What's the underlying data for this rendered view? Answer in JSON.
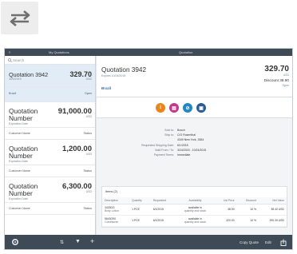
{
  "toggle_icon": "swap-arrows-icon",
  "topbar": {
    "menu_icon": "menu-icon",
    "left_title": "My Quotations",
    "right_title": "Quotation"
  },
  "master": {
    "search_placeholder": "Search",
    "items": [
      {
        "title": "Quotation 3942",
        "subtitle": "3/24/2015",
        "amount": "329.70",
        "currency": "USD",
        "label": "Brazil",
        "status": "Open"
      },
      {
        "title": "Quotation Number",
        "subtitle": "Expiration Date",
        "amount": "91,000.00",
        "currency": "USD",
        "label": "Customer Name",
        "status": "Status"
      },
      {
        "title": "Quotation Number",
        "subtitle": "Expiration Date",
        "amount": "1,200.00",
        "currency": "USD",
        "label": "Customer Name",
        "status": "Status"
      },
      {
        "title": "Quotation Number",
        "subtitle": "Expiration Date",
        "amount": "6,300.00",
        "currency": "USD",
        "label": "Customer Name",
        "status": "Status"
      }
    ]
  },
  "detail": {
    "title": "Quotation 3942",
    "subtitle": "Expires 10/24/2015",
    "status": "Brazil",
    "total": "329.70",
    "currency": "USD",
    "discount": "Discount 38.90",
    "open_label": "Open",
    "icons": [
      {
        "name": "info-icon",
        "glyph": "i",
        "color": "#e8861e"
      },
      {
        "name": "notes-icon",
        "glyph": "▤",
        "color": "#c0388a"
      },
      {
        "name": "attachment-icon",
        "glyph": "⊘",
        "color": "#1f86c7"
      },
      {
        "name": "contacts-icon",
        "glyph": "▣",
        "color": "#2a5d93"
      }
    ],
    "info": [
      {
        "key": "Sold to:",
        "value": "Bosch"
      },
      {
        "key": "Ship to:",
        "value": "C/O Rosenthal"
      },
      {
        "key": "",
        "value": "4349 New York, 3384"
      },
      {
        "key": "Requested Shipping Date:",
        "value": "6/1/2015"
      },
      {
        "key": "Valid From / To:",
        "value": "3/24/2015 - 10/24/2015"
      },
      {
        "key": "Payment Terms:",
        "value": "Immediate"
      }
    ],
    "items_title": "Items (2)",
    "columns": [
      "Description",
      "Quantity",
      "Requested",
      "Availability",
      "List Price",
      "Discount",
      "Net Value"
    ],
    "rows": [
      {
        "description": "3433DG",
        "desc_sub": "Body Lotion",
        "quantity": "1 PCE",
        "requested": "6/1/2015",
        "availability": "available in",
        "avail_sub": "quantity and stock",
        "list_price": "38.90",
        "discount": "10 %",
        "net_value": "38.40 USD"
      },
      {
        "description": "5643O90",
        "desc_sub": "Conditioner",
        "quantity": "1 PCE",
        "requested": "6/1/2015",
        "availability": "available in",
        "avail_sub": "quantity and stock",
        "list_price": "320.00",
        "discount": "10 %",
        "net_value": "290.30 USD"
      }
    ]
  },
  "bottombar": {
    "settings_icon": "gear-icon",
    "sort_icon": "sort-icon",
    "filter_icon": "filter-icon",
    "add_icon": "add-icon",
    "copy_label": "Copy Quote",
    "edit_label": "Edit",
    "share_icon": "share-icon"
  }
}
